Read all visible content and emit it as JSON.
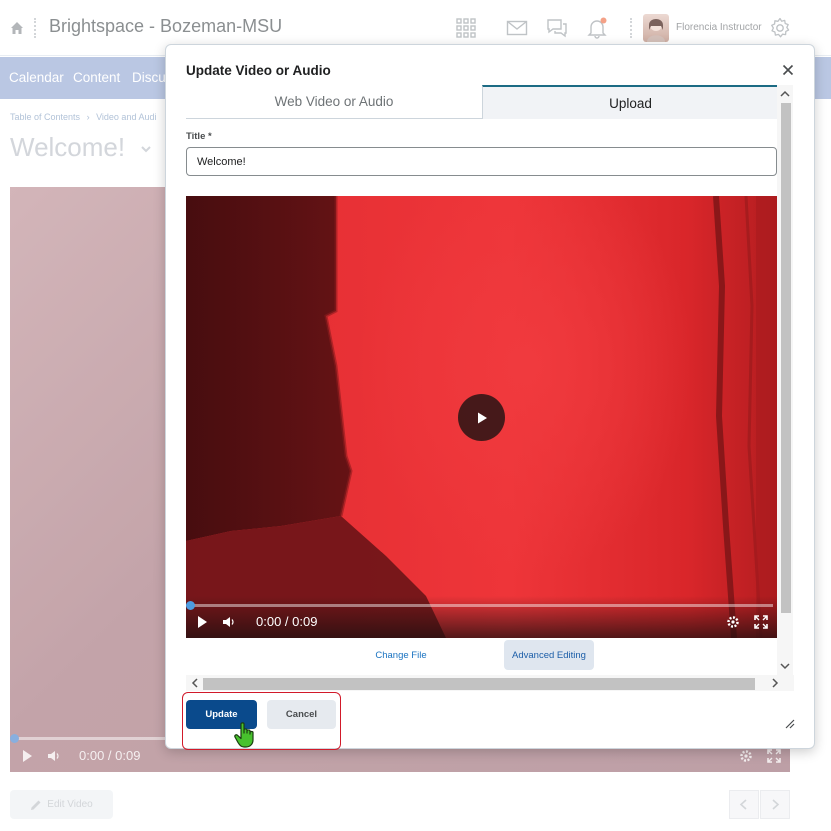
{
  "header": {
    "org_title": "Brightspace - Bozeman-MSU",
    "user_name": "Florencia Instructor"
  },
  "nav": {
    "items": [
      "Calendar",
      "Content",
      "Discu"
    ]
  },
  "breadcrumb": {
    "items": [
      "Table of Contents",
      "›",
      "Video and Audi"
    ]
  },
  "page": {
    "title": "Welcome!",
    "video_time": "0:00 / 0:09",
    "edit_video_label": "Edit Video"
  },
  "dialog": {
    "title": "Update Video or Audio",
    "tabs": {
      "web": "Web Video or Audio",
      "upload": "Upload"
    },
    "title_field_label": "Title",
    "title_field_required": "*",
    "title_field_value": "Welcome!",
    "video_time": "0:00 / 0:09",
    "change_file_label": "Change File",
    "advanced_editing_label": "Advanced Editing",
    "update_label": "Update",
    "cancel_label": "Cancel"
  },
  "colors": {
    "primary_button": "#0a4a8c",
    "nav_bar": "#a9b9dc",
    "highlight": "#d11a2a",
    "tab_accent": "#1c6b84"
  }
}
